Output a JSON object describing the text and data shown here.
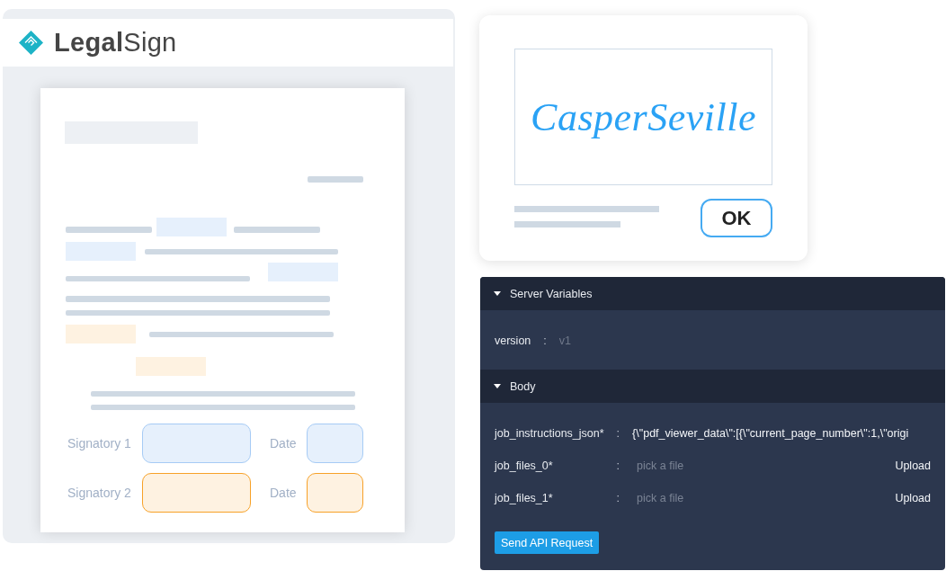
{
  "signing_app": {
    "logo": {
      "text": "**Legal**Sign"
    },
    "document": {
      "signatories": [
        {
          "label": "Signatory 1",
          "date_label": "Date",
          "color": "#a6cbf5"
        },
        {
          "label": "Signatory 2",
          "date_label": "Date",
          "color": "#f7a128"
        }
      ]
    }
  },
  "signature_dialog": {
    "signature": "CasperSeville",
    "button": "OK"
  },
  "api_console": {
    "sections": [
      {
        "title": "Server Variables",
        "expanded": true,
        "fields": [
          {
            "kind": "text",
            "label": "version",
            "separator": ":",
            "placeholder": "v1"
          }
        ]
      },
      {
        "title": "Body",
        "expanded": true,
        "fields": [
          {
            "kind": "text",
            "label": "job_instructions_json*",
            "separator": ":",
            "value": "{\\\"pdf_viewer_data\\\":[{\\\"current_page_number\\\":1,\\\"origi"
          },
          {
            "kind": "file",
            "label": "job_files_0*",
            "separator": ":",
            "placeholder": "pick a file",
            "button": "Upload"
          },
          {
            "kind": "file",
            "label": "job_files_1*",
            "separator": ":",
            "placeholder": "pick a file",
            "button": "Upload"
          }
        ],
        "action_button": "Send API Request"
      }
    ]
  }
}
